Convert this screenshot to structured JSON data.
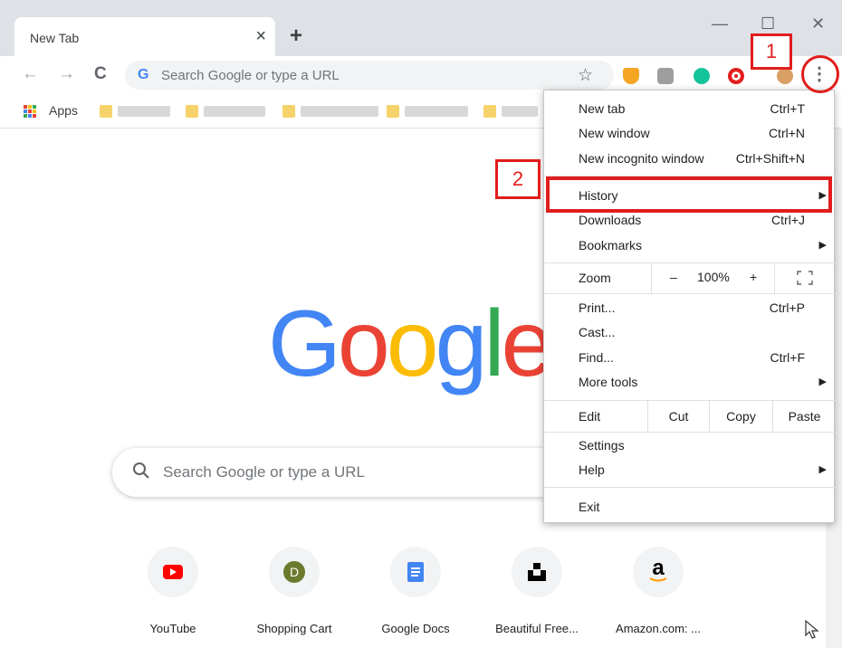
{
  "tab": {
    "title": "New Tab",
    "close": "×",
    "new_tab": "+"
  },
  "window_controls": {
    "minimize": "—",
    "maximize": "☐",
    "close": "✕"
  },
  "toolbar": {
    "back": "←",
    "forward": "→",
    "reload": "C",
    "omnibox_g": "G",
    "omnibox_placeholder": "Search Google or type a URL",
    "star": "☆",
    "menu": "⋮"
  },
  "bookmarks": {
    "apps_label": "Apps"
  },
  "google_logo": [
    "G",
    "o",
    "o",
    "g",
    "l",
    "e"
  ],
  "google_colors": [
    "#4285f4",
    "#ea4335",
    "#fbbc05",
    "#4285f4",
    "#34a853",
    "#ea4335"
  ],
  "searchbox": {
    "placeholder": "Search Google or type a URL"
  },
  "shortcuts": [
    {
      "label": "YouTube",
      "icon": "youtube-icon"
    },
    {
      "label": "Shopping Cart",
      "icon": "letter-d-icon",
      "letter": "D"
    },
    {
      "label": "Google Docs",
      "icon": "docs-icon"
    },
    {
      "label": "Beautiful Free...",
      "icon": "unsplash-icon"
    },
    {
      "label": "Amazon.com: ...",
      "icon": "amazon-icon",
      "letter": "a"
    }
  ],
  "menu": {
    "new_tab": {
      "label": "New tab",
      "shortcut": "Ctrl+T"
    },
    "new_window": {
      "label": "New window",
      "shortcut": "Ctrl+N"
    },
    "new_incognito": {
      "label": "New incognito window",
      "shortcut": "Ctrl+Shift+N"
    },
    "history": {
      "label": "History"
    },
    "downloads": {
      "label": "Downloads",
      "shortcut": "Ctrl+J"
    },
    "bookmarks": {
      "label": "Bookmarks"
    },
    "zoom": {
      "label": "Zoom",
      "minus": "–",
      "value": "100%",
      "plus": "+"
    },
    "print": {
      "label": "Print...",
      "shortcut": "Ctrl+P"
    },
    "cast": {
      "label": "Cast..."
    },
    "find": {
      "label": "Find...",
      "shortcut": "Ctrl+F"
    },
    "more_tools": {
      "label": "More tools"
    },
    "edit": {
      "label": "Edit",
      "cut": "Cut",
      "copy": "Copy",
      "paste": "Paste"
    },
    "settings": {
      "label": "Settings"
    },
    "help": {
      "label": "Help"
    },
    "exit": {
      "label": "Exit"
    },
    "submenu_arrow": "▶"
  },
  "annotations": {
    "step1": "1",
    "step2": "2"
  },
  "colors": {
    "annotation_red": "#e21d1d",
    "accent_blue": "#4285f4"
  }
}
